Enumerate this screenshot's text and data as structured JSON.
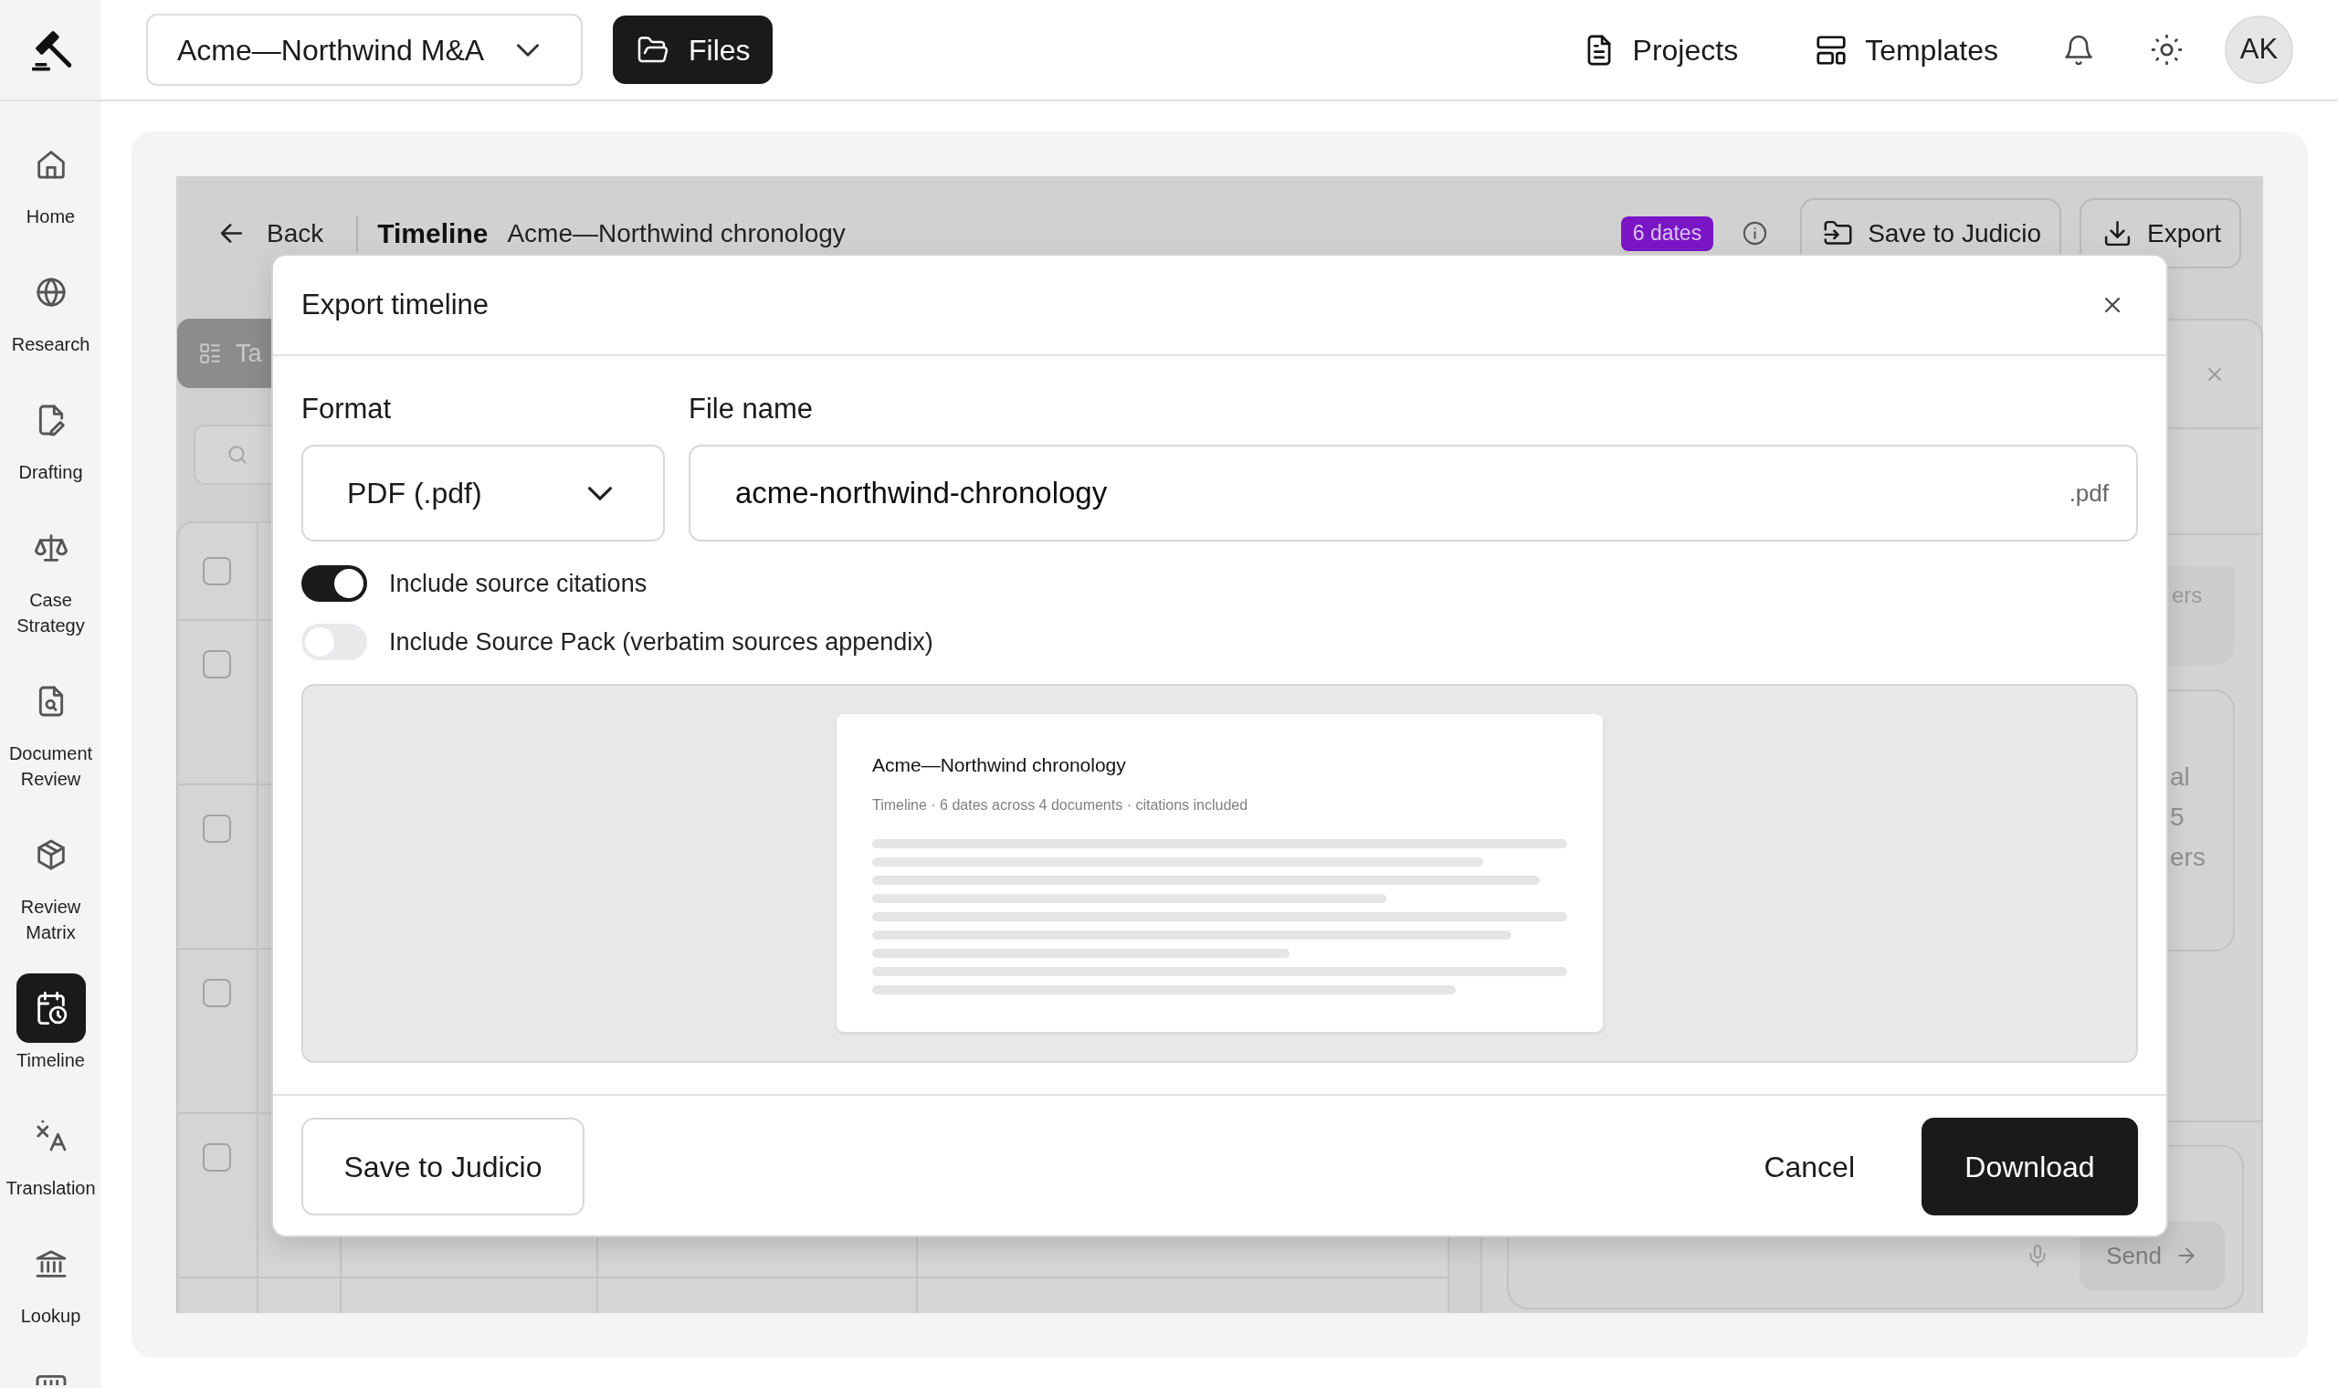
{
  "sidebar": {
    "items": [
      {
        "kind": "home",
        "label": "Home",
        "selected": false
      },
      {
        "kind": "research",
        "label": "Research",
        "selected": false
      },
      {
        "kind": "drafting",
        "label": "Drafting",
        "selected": false
      },
      {
        "kind": "case_strategy",
        "label": "Case Strategy",
        "selected": false
      },
      {
        "kind": "document_review",
        "label": "Document Review",
        "selected": false
      },
      {
        "kind": "review_matrix",
        "label": "Review Matrix",
        "selected": false
      },
      {
        "kind": "timeline",
        "label": "Timeline",
        "selected": true
      },
      {
        "kind": "translation",
        "label": "Translation",
        "selected": false
      },
      {
        "kind": "lookup",
        "label": "Lookup",
        "selected": false
      },
      {
        "kind": "keypad",
        "selected": false
      }
    ]
  },
  "top_bar": {
    "project": "Acme—Northwind M&A",
    "files_button": "Files",
    "links": [
      {
        "kind": "projects",
        "label": "Projects"
      },
      {
        "kind": "templates",
        "label": "Templates"
      }
    ],
    "avatar": "AK"
  },
  "timeline_header": {
    "back": "Back",
    "title": "Timeline",
    "subtitle": "Acme—Northwind chronology",
    "badge": "6 dates",
    "buttons": [
      {
        "kind": "save",
        "label": "Save to Judicio"
      },
      {
        "kind": "export",
        "label": "Export"
      }
    ]
  },
  "view_tabs": [
    {
      "label": "Ta",
      "selected": true
    }
  ],
  "table": {
    "select_all": {
      "checked": false
    },
    "rows": [
      {
        "checked": false
      },
      {
        "checked": false
      },
      {
        "checked": false
      },
      {
        "checked": false
      }
    ]
  },
  "side_panel": {
    "chip": "ers",
    "card_lines": [
      "al",
      "5",
      "ers"
    ],
    "send_button": {
      "label": "Send",
      "disabled": true
    }
  },
  "export_dialog": {
    "title": "Export timeline",
    "format": {
      "label": "Format",
      "value": "PDF (.pdf)"
    },
    "file_name": {
      "label": "File name",
      "value": "acme-northwind-chronology",
      "suffix": ".pdf"
    },
    "options": [
      {
        "label": "Include source citations",
        "on": true
      },
      {
        "label": "Include Source Pack (verbatim sources appendix)",
        "on": false
      }
    ],
    "preview": {
      "title": "Acme—Northwind chronology",
      "meta": "Timeline · 6 dates across 4 documents · citations included"
    },
    "buttons": [
      {
        "kind": "secondary",
        "label": "Save to Judicio"
      },
      {
        "kind": "link",
        "label": "Cancel"
      },
      {
        "kind": "primary",
        "label": "Download"
      }
    ]
  }
}
